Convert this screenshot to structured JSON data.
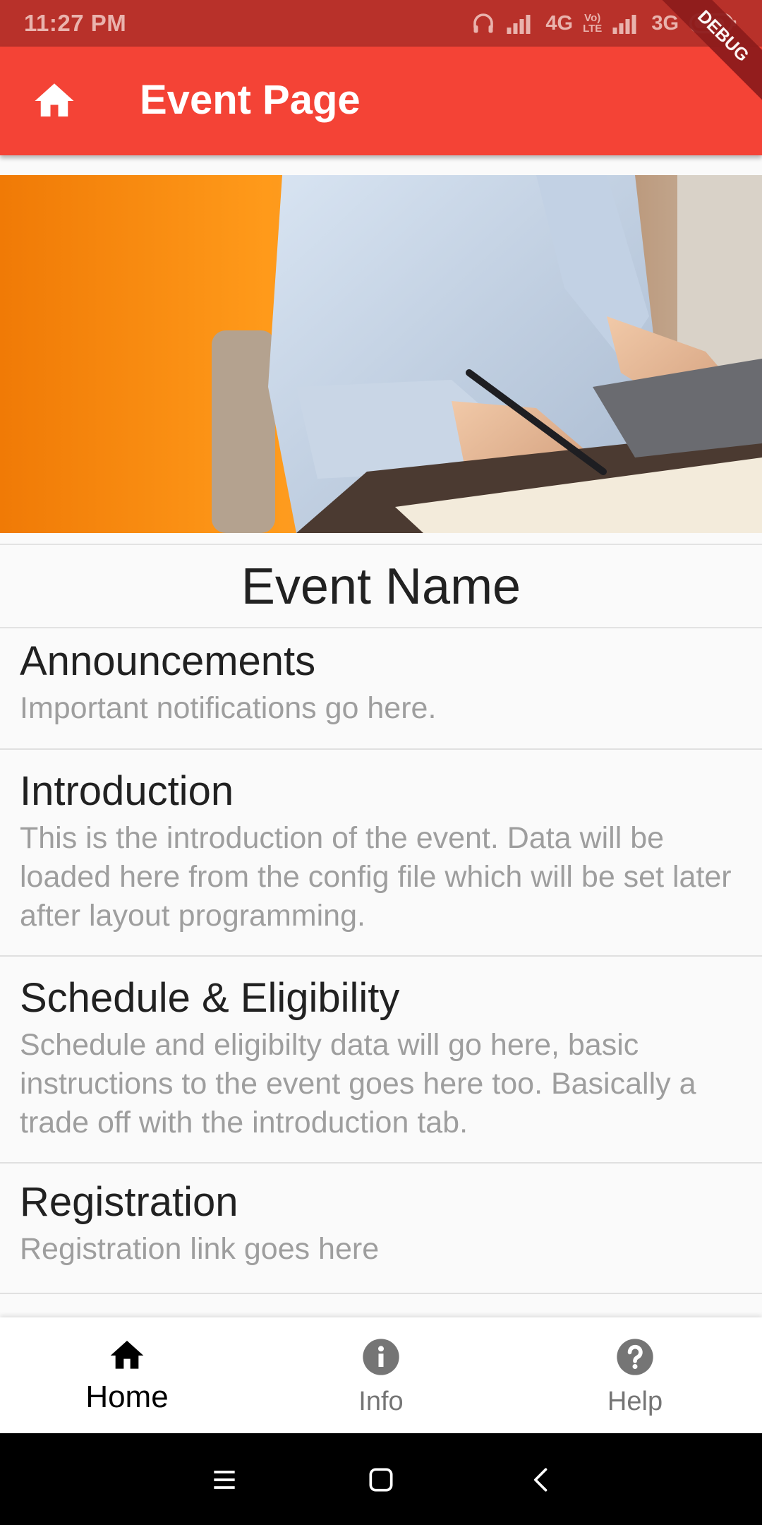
{
  "status_bar": {
    "time": "11:27 PM",
    "network_1": "4G",
    "volte_line_1": "Vo)",
    "volte_line_2": "LTE",
    "network_2": "3G"
  },
  "debug_banner": "DEBUG",
  "app_bar": {
    "title": "Event Page",
    "home_icon": "home-icon"
  },
  "event": {
    "name": "Event Name"
  },
  "sections": [
    {
      "title": "Announcements",
      "body": "Important notifications go here."
    },
    {
      "title": "Introduction",
      "body": "This is the introduction of the event. Data will be loaded here from the config file which will be set later after layout programming."
    },
    {
      "title": "Schedule & Eligibility",
      "body": "Schedule and eligibilty data will go here, basic instructions to the event goes here too. Basically a trade off with the introduction tab."
    },
    {
      "title": "Registration",
      "body": "Registration link goes here"
    }
  ],
  "bottom_nav": [
    {
      "label": "Home",
      "icon": "home-icon",
      "active": true
    },
    {
      "label": "Info",
      "icon": "info-icon",
      "active": false
    },
    {
      "label": "Help",
      "icon": "help-icon",
      "active": false
    }
  ],
  "colors": {
    "status_bar": "#b8312a",
    "app_bar": "#f44336",
    "debug_banner": "#8e1c1c",
    "title_text": "#212121",
    "secondary_text": "#9e9e9e",
    "nav_active": "#000000",
    "nav_inactive": "#757575"
  }
}
